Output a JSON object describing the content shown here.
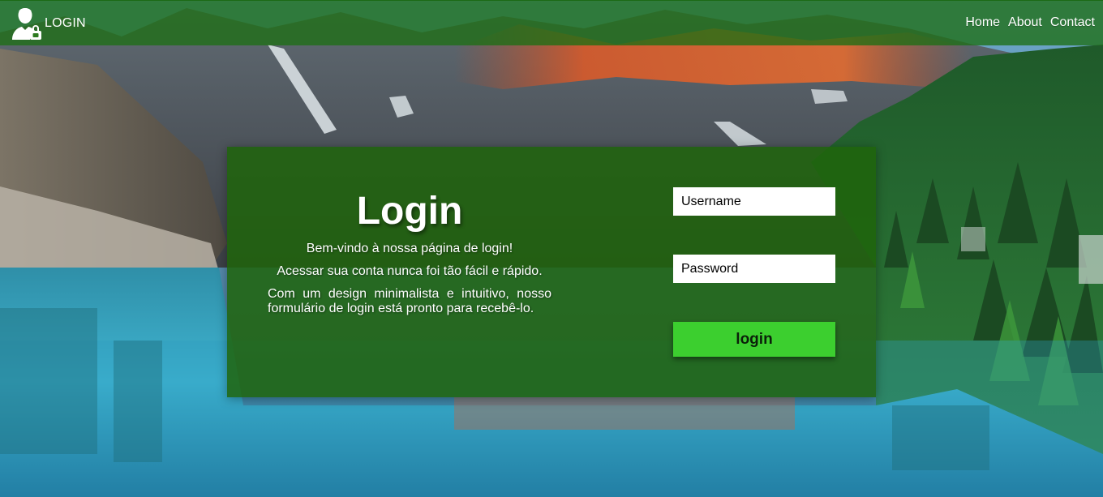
{
  "navbar": {
    "brand_label": "LOGIN",
    "brand_icon": "user-lock-icon",
    "links": [
      "Home",
      "About",
      "Contact"
    ]
  },
  "card": {
    "title": "Login",
    "welcome_lines": [
      "Bem-vindo à nossa página de login!",
      "Acessar sua conta nunca foi tão fácil e rápido.",
      "Com um design minimalista e intuitivo, nosso formulário de login está pronto para recebê-lo."
    ]
  },
  "form": {
    "username_placeholder": "Username",
    "password_placeholder": "Password",
    "submit_label": "login"
  },
  "colors": {
    "navbar_bg": "#2d7a1f",
    "card_bg": "#1e640a",
    "button_bg": "#3ccf2f",
    "text": "#ffffff"
  }
}
